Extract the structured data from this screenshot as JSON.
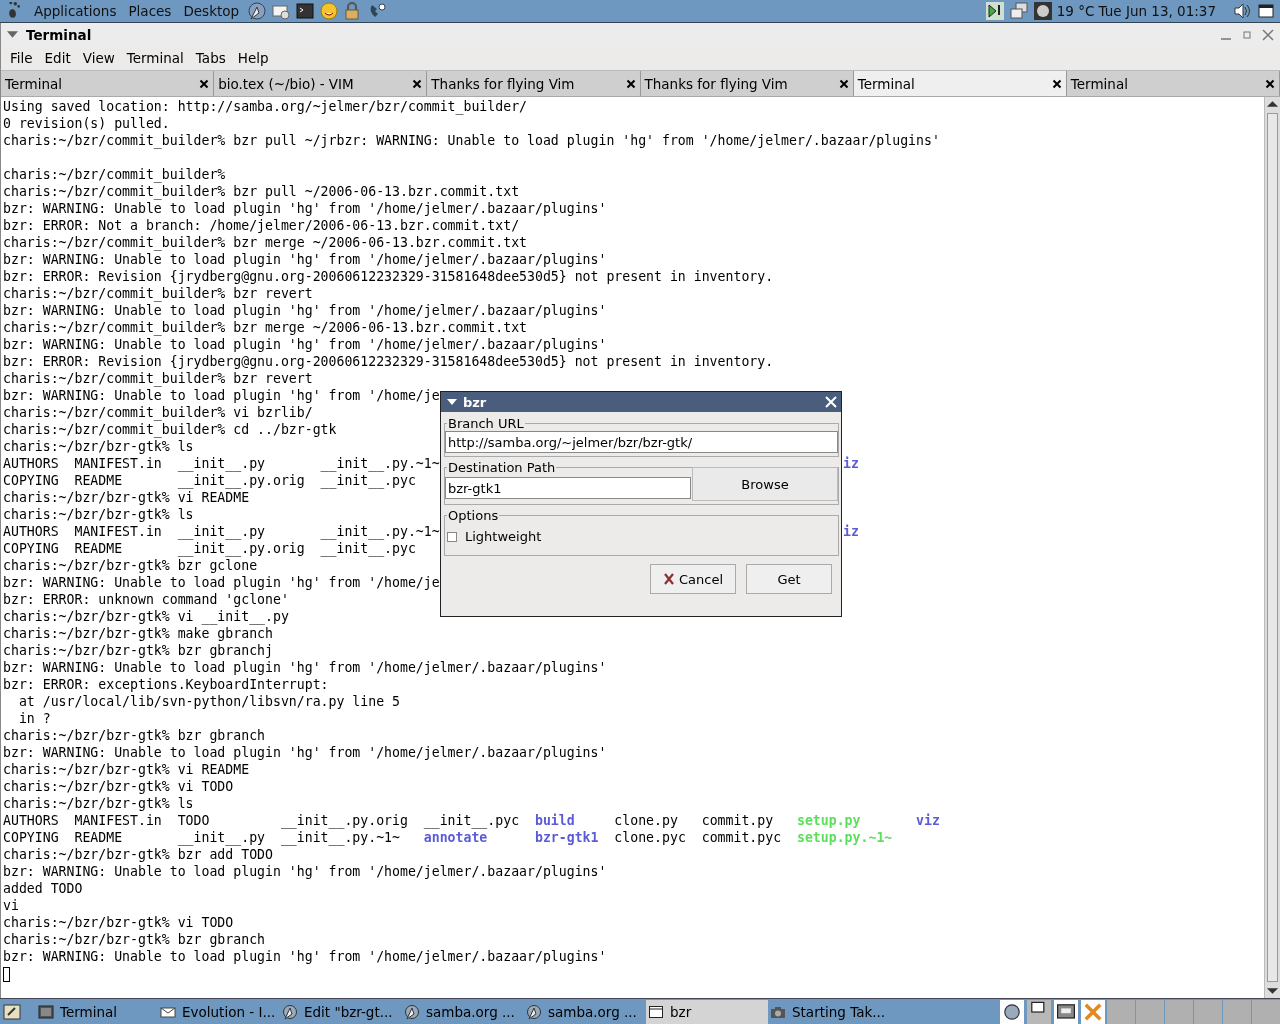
{
  "top_panel": {
    "menus": [
      "Applications",
      "Places",
      "Desktop"
    ],
    "clock": "19 °C Tue Jun 13, 01:37"
  },
  "window": {
    "title": "Terminal"
  },
  "menu": [
    "File",
    "Edit",
    "View",
    "Terminal",
    "Tabs",
    "Help"
  ],
  "tabs": [
    {
      "label": "Terminal",
      "selected": false
    },
    {
      "label": "bio.tex (~/bio) - VIM",
      "selected": false
    },
    {
      "label": "Thanks for flying Vim",
      "selected": false
    },
    {
      "label": "Thanks for flying Vim",
      "selected": false
    },
    {
      "label": "Terminal",
      "selected": true
    },
    {
      "label": "Terminal",
      "selected": false
    }
  ],
  "terminal": {
    "lines": [
      {
        "kind": "plain",
        "text": "Using saved location: http://samba.org/~jelmer/bzr/commit_builder/"
      },
      {
        "kind": "plain",
        "text": "0 revision(s) pulled."
      },
      {
        "kind": "plain",
        "text": "charis:~/bzr/commit_builder% bzr pull ~/jrbzr: WARNING: Unable to load plugin 'hg' from '/home/jelmer/.bazaar/plugins'"
      },
      {
        "kind": "blank"
      },
      {
        "kind": "plain",
        "text": "charis:~/bzr/commit_builder%"
      },
      {
        "kind": "plain",
        "text": "charis:~/bzr/commit_builder% bzr pull ~/2006-06-13.bzr.commit.txt"
      },
      {
        "kind": "plain",
        "text": "bzr: WARNING: Unable to load plugin 'hg' from '/home/jelmer/.bazaar/plugins'"
      },
      {
        "kind": "plain",
        "text": "bzr: ERROR: Not a branch: /home/jelmer/2006-06-13.bzr.commit.txt/"
      },
      {
        "kind": "plain",
        "text": "charis:~/bzr/commit_builder% bzr merge ~/2006-06-13.bzr.commit.txt"
      },
      {
        "kind": "plain",
        "text": "bzr: WARNING: Unable to load plugin 'hg' from '/home/jelmer/.bazaar/plugins'"
      },
      {
        "kind": "plain",
        "text": "bzr: ERROR: Revision {jrydberg@gnu.org-20060612232329-31581648dee530d5} not present in inventory."
      },
      {
        "kind": "plain",
        "text": "charis:~/bzr/commit_builder% bzr revert"
      },
      {
        "kind": "plain",
        "text": "bzr: WARNING: Unable to load plugin 'hg' from '/home/jelmer/.bazaar/plugins'"
      },
      {
        "kind": "plain",
        "text": "charis:~/bzr/commit_builder% bzr merge ~/2006-06-13.bzr.commit.txt"
      },
      {
        "kind": "plain",
        "text": "bzr: WARNING: Unable to load plugin 'hg' from '/home/jelmer/.bazaar/plugins'"
      },
      {
        "kind": "plain",
        "text": "bzr: ERROR: Revision {jrydberg@gnu.org-20060612232329-31581648dee530d5} not present in inventory."
      },
      {
        "kind": "plain",
        "text": "charis:~/bzr/commit_builder% bzr revert"
      },
      {
        "kind": "plain",
        "text": "bzr: WARNING: Unable to load plugin 'hg' from '/home/je"
      },
      {
        "kind": "plain",
        "text": "charis:~/bzr/commit_builder% vi bzrlib/"
      },
      {
        "kind": "plain",
        "text": "charis:~/bzr/commit_builder% cd ../bzr-gtk"
      },
      {
        "kind": "plain",
        "text": "charis:~/bzr/bzr-gtk% ls"
      },
      {
        "kind": "listing",
        "segments": [
          {
            "text": "AUTHORS  MANIFEST.in  __init__.py       __init__.py.~1~",
            "kind": "plain"
          },
          {
            "text": "iz",
            "kind": "dir",
            "beyond_dialog": true
          }
        ]
      },
      {
        "kind": "listing",
        "segments": [
          {
            "text": "COPYING  README       __init__.py.orig  __init__.pyc",
            "kind": "plain"
          }
        ]
      },
      {
        "kind": "plain",
        "text": "charis:~/bzr/bzr-gtk% vi README"
      },
      {
        "kind": "plain",
        "text": "charis:~/bzr/bzr-gtk% ls"
      },
      {
        "kind": "listing",
        "segments": [
          {
            "text": "AUTHORS  MANIFEST.in  __init__.py       __init__.py.~1~",
            "kind": "plain"
          },
          {
            "text": "iz",
            "kind": "dir",
            "beyond_dialog": true
          }
        ]
      },
      {
        "kind": "listing",
        "segments": [
          {
            "text": "COPYING  README       __init__.py.orig  __init__.pyc",
            "kind": "plain"
          }
        ]
      },
      {
        "kind": "plain",
        "text": "charis:~/bzr/bzr-gtk% bzr gclone"
      },
      {
        "kind": "plain",
        "text": "bzr: WARNING: Unable to load plugin 'hg' from '/home/je"
      },
      {
        "kind": "plain",
        "text": "bzr: ERROR: unknown command 'gclone'"
      },
      {
        "kind": "plain",
        "text": "charis:~/bzr/bzr-gtk% vi __init__.py"
      },
      {
        "kind": "plain",
        "text": "charis:~/bzr/bzr-gtk% make gbranch"
      },
      {
        "kind": "plain",
        "text": "charis:~/bzr/bzr-gtk% bzr gbranchj"
      },
      {
        "kind": "plain",
        "text": "bzr: WARNING: Unable to load plugin 'hg' from '/home/jelmer/.bazaar/plugins'"
      },
      {
        "kind": "plain",
        "text": "bzr: ERROR: exceptions.KeyboardInterrupt:"
      },
      {
        "kind": "plain",
        "text": "  at /usr/local/lib/svn-python/libsvn/ra.py line 5"
      },
      {
        "kind": "plain",
        "text": "  in ?"
      },
      {
        "kind": "plain",
        "text": "charis:~/bzr/bzr-gtk% bzr gbranch"
      },
      {
        "kind": "plain",
        "text": "bzr: WARNING: Unable to load plugin 'hg' from '/home/jelmer/.bazaar/plugins'"
      },
      {
        "kind": "plain",
        "text": "charis:~/bzr/bzr-gtk% vi README"
      },
      {
        "kind": "plain",
        "text": "charis:~/bzr/bzr-gtk% vi TODO"
      },
      {
        "kind": "plain",
        "text": "charis:~/bzr/bzr-gtk% ls"
      },
      {
        "kind": "listing",
        "segments": [
          {
            "text": "AUTHORS  MANIFEST.in  TODO         __init__.py.orig  __init__.pyc  ",
            "kind": "plain"
          },
          {
            "text": "build",
            "kind": "dir"
          },
          {
            "text": "     clone.py   commit.py   ",
            "kind": "plain"
          },
          {
            "text": "setup.py",
            "kind": "exec"
          },
          {
            "text": "       viz",
            "kind": "dir"
          }
        ]
      },
      {
        "kind": "listing",
        "segments": [
          {
            "text": "COPYING  README       __init__.py  __init__.py.~1~   ",
            "kind": "plain"
          },
          {
            "text": "annotate",
            "kind": "dir"
          },
          {
            "text": "      bzr-gtk1",
            "kind": "dir"
          },
          {
            "text": "  clone.pyc  commit.pyc  ",
            "kind": "plain"
          },
          {
            "text": "setup.py.~1~",
            "kind": "exec"
          }
        ]
      },
      {
        "kind": "plain",
        "text": "charis:~/bzr/bzr-gtk% bzr add TODO"
      },
      {
        "kind": "plain",
        "text": "bzr: WARNING: Unable to load plugin 'hg' from '/home/jelmer/.bazaar/plugins'"
      },
      {
        "kind": "plain",
        "text": "added TODO"
      },
      {
        "kind": "plain",
        "text": "vi"
      },
      {
        "kind": "plain",
        "text": "charis:~/bzr/bzr-gtk% vi TODO"
      },
      {
        "kind": "plain",
        "text": "charis:~/bzr/bzr-gtk% bzr gbranch"
      },
      {
        "kind": "plain",
        "text": "bzr: WARNING: Unable to load plugin 'hg' from '/home/jelmer/.bazaar/plugins'"
      },
      {
        "kind": "cursor"
      }
    ]
  },
  "dialog": {
    "title": "bzr",
    "branch_url": {
      "label": "Branch URL",
      "value": "http://samba.org/~jelmer/bzr/bzr-gtk/"
    },
    "destination": {
      "label": "Destination Path",
      "value": "bzr-gtk1",
      "browse": "Browse"
    },
    "options": {
      "label": "Options",
      "items": [
        {
          "label": "Lightweight",
          "checked": false
        }
      ]
    },
    "buttons": [
      {
        "kind": "cancel",
        "label": "Cancel"
      },
      {
        "kind": "ok",
        "label": "Get"
      }
    ]
  },
  "taskbar": {
    "items": [
      {
        "label": "Terminal",
        "kind": "terminal",
        "selected": false
      },
      {
        "label": "Evolution - I...",
        "kind": "mail",
        "selected": false
      },
      {
        "label": "Edit \"bzr-gt...",
        "kind": "browser",
        "selected": false
      },
      {
        "label": "samba.org ...",
        "kind": "browser",
        "selected": false
      },
      {
        "label": "samba.org ...",
        "kind": "browser",
        "selected": false
      },
      {
        "label": "bzr",
        "kind": "window",
        "selected": true
      },
      {
        "label": "Starting Tak...",
        "kind": "camera",
        "selected": false
      }
    ]
  }
}
